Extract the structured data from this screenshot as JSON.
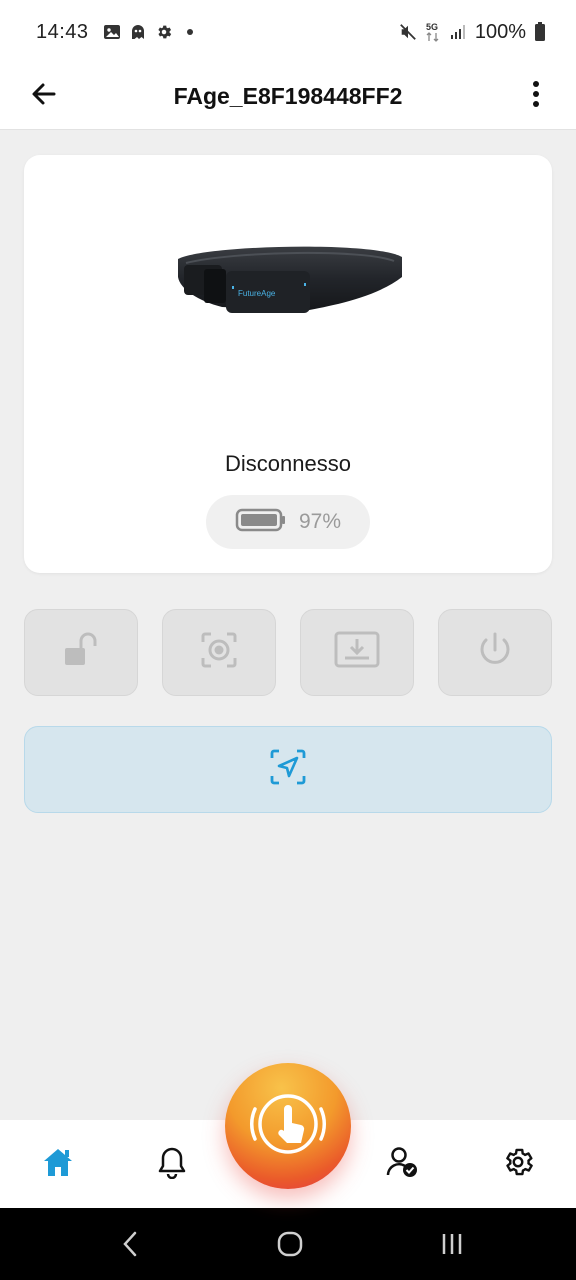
{
  "status_bar": {
    "time": "14:43",
    "battery_percent": "100%",
    "left_icons": [
      "image-icon",
      "ghost-icon",
      "gear-icon",
      "dot-icon"
    ],
    "right_icons": [
      "mute-icon",
      "5g-icon",
      "signal-icon",
      "battery-icon"
    ]
  },
  "app_bar": {
    "title": "FAge_E8F198448FF2",
    "back_icon": "arrow-left-icon",
    "menu_icon": "more-vertical-icon"
  },
  "device": {
    "status": "Disconnesso",
    "battery": "97%",
    "battery_level": 0.97,
    "image_brand_text": "FutureAge"
  },
  "actions": [
    {
      "name": "unlock",
      "icon": "unlock-icon",
      "enabled": false
    },
    {
      "name": "capture",
      "icon": "focus-capture-icon",
      "enabled": false
    },
    {
      "name": "download",
      "icon": "download-tray-icon",
      "enabled": false
    },
    {
      "name": "power",
      "icon": "power-icon",
      "enabled": false
    }
  ],
  "locate_button": {
    "icon": "navigation-locate-icon"
  },
  "bottom_nav": {
    "items": [
      {
        "name": "home",
        "icon": "home-icon",
        "active": true
      },
      {
        "name": "notifications",
        "icon": "bell-icon",
        "active": false
      },
      {
        "name": "sos",
        "icon": "sos-touch-icon",
        "active": false
      },
      {
        "name": "profile",
        "icon": "user-check-icon",
        "active": false
      },
      {
        "name": "settings",
        "icon": "gear-icon",
        "active": false
      }
    ]
  },
  "colors": {
    "accent": "#1e9ad6",
    "sos_gradient": [
      "#f8c24a",
      "#f39a2c",
      "#e4304a"
    ],
    "disabled_button": "#e2e2e2",
    "locate_bg": "#d6e6ee"
  }
}
